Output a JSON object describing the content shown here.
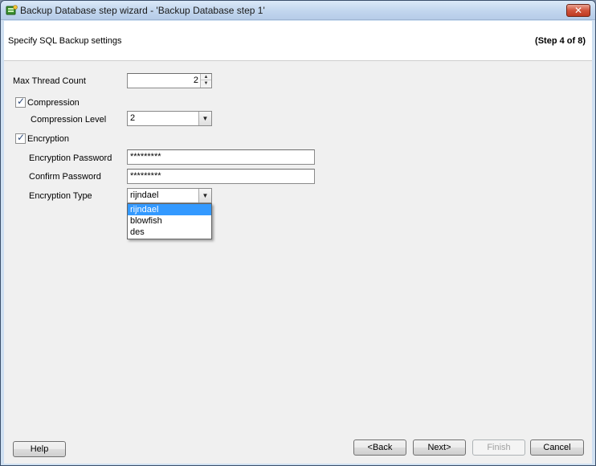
{
  "window": {
    "title": "Backup Database step wizard - 'Backup Database step 1'",
    "close_glyph": "✕"
  },
  "header": {
    "subtitle": "Specify SQL Backup settings",
    "step": "(Step 4 of 8)"
  },
  "form": {
    "max_thread_count": {
      "label": "Max Thread Count",
      "value": "2"
    },
    "compression": {
      "label": "Compression",
      "checked": true
    },
    "compression_level": {
      "label": "Compression Level",
      "value": "2"
    },
    "encryption": {
      "label": "Encryption",
      "checked": true
    },
    "encryption_password": {
      "label": "Encryption Password",
      "value": "*********"
    },
    "confirm_password": {
      "label": "Confirm Password",
      "value": "*********"
    },
    "encryption_type": {
      "label": "Encryption Type",
      "value": "rijndael",
      "options": [
        "rijndael",
        "blowfish",
        "des"
      ]
    }
  },
  "footer": {
    "help": "Help",
    "back": "<Back",
    "next": "Next>",
    "finish": "Finish",
    "cancel": "Cancel"
  },
  "colors": {
    "selection": "#3399ff",
    "close_button": "#d0533b"
  }
}
